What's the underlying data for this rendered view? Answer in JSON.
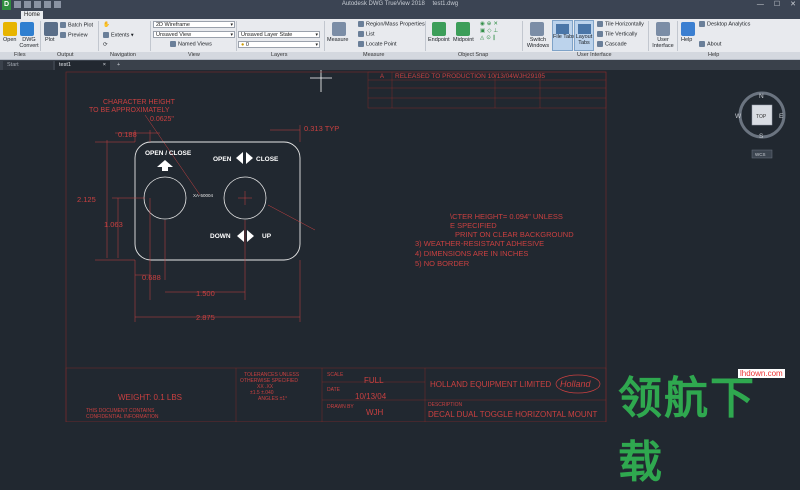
{
  "window": {
    "title": "Autodesk DWG TrueView 2018",
    "file": "test1.dwg"
  },
  "tabs": {
    "home": "Home"
  },
  "ribbon": {
    "open": "Open",
    "dwg_convert": "DWG Convert",
    "plot": "Plot",
    "batch_plot": "Batch Plot",
    "preview": "Preview",
    "extents": "Extents",
    "visual_style": "2D Wireframe",
    "saved_view": "Unsaved View",
    "named_views": "Named Views",
    "layer_state": "Unsaved Layer State",
    "layer_current": "0",
    "measure": "Measure",
    "region_mass": "Region/Mass Properties",
    "list": "List",
    "locate_point": "Locate Point",
    "endpoint": "Endpoint",
    "midpoint": "Midpoint",
    "switch_windows": "Switch Windows",
    "file_tabs": "File Tabs",
    "layout_tabs": "Layout Tabs",
    "tile_h": "Tile Horizontally",
    "tile_v": "Tile Vertically",
    "cascade": "Cascade",
    "user_interface": "User Interface",
    "help": "Help",
    "desktop_analytics": "Desktop Analytics",
    "about": "About",
    "panel_labels": [
      "Files",
      "Output",
      "Navigation",
      "View",
      "Layers",
      "Measure",
      "Object Snap",
      "User Interface",
      "Help"
    ]
  },
  "doc_tabs": {
    "start": "Start",
    "current": "test1",
    "add": "+"
  },
  "viewcube": {
    "n": "N",
    "s": "S",
    "e": "E",
    "w": "W",
    "top": "TOP",
    "wcs": "WCS"
  },
  "drawing": {
    "note_char_height": "CHARACTER HEIGHT",
    "note_to_be": "TO BE APPROXIMATELY",
    "note_val": "0.0625\"",
    "dim_0188": "0.188",
    "dim_0313": "0.313 TYP",
    "dim_2125": "2.125",
    "dim_1063": "1.063",
    "dim_0688": "0.688",
    "dim_1500": "1.500",
    "dim_2875": "2.875",
    "label_open_close": "OPEN / CLOSE",
    "label_open": "OPEN",
    "label_close": "CLOSE",
    "label_down": "DOWN",
    "label_up": "UP",
    "part_no": "XA-50004",
    "release_a": "A",
    "release_text": "RELEASED TO PRODUCTION 10/13/04WJH29105",
    "notes": [
      "\\CTER HEIGHT= 0.094\" UNLESS",
      "E SPECIFIED",
      "PRINT ON CLEAR BACKGROUND",
      "3) WEATHER-RESISTANT ADHESIVE",
      "4) DIMENSIONS ARE IN INCHES",
      "5) NO BORDER"
    ],
    "weight": "WEIGHT: 0.1 LBS",
    "tol_1": "TOLERANCES UNLESS",
    "tol_2": "OTHERWISE SPECIFIED",
    "tol_3": "XX      .XX",
    "tol_4": "±1.5  ±.040",
    "tol_5": "ANGLES ±1°",
    "scale_label": "SCALE",
    "scale_val": "FULL",
    "date_label": "DATE",
    "date_val": "10/13/04",
    "drawn_label": "DRAWN BY",
    "drawn_val": "WJH",
    "company": "HOLLAND EQUIPMENT LIMITED",
    "logo": "Holland",
    "desc_label": "DESCRIPTION",
    "desc_val": "DECAL DUAL TOGGLE HORIZONTAL MOUNT",
    "conf_1": "THIS DOCUMENT CONTAINS",
    "conf_2": "CONFIDENTIAL INFORMATION"
  },
  "watermark": {
    "cn": "领航下载",
    "url": "lhdown.com"
  }
}
